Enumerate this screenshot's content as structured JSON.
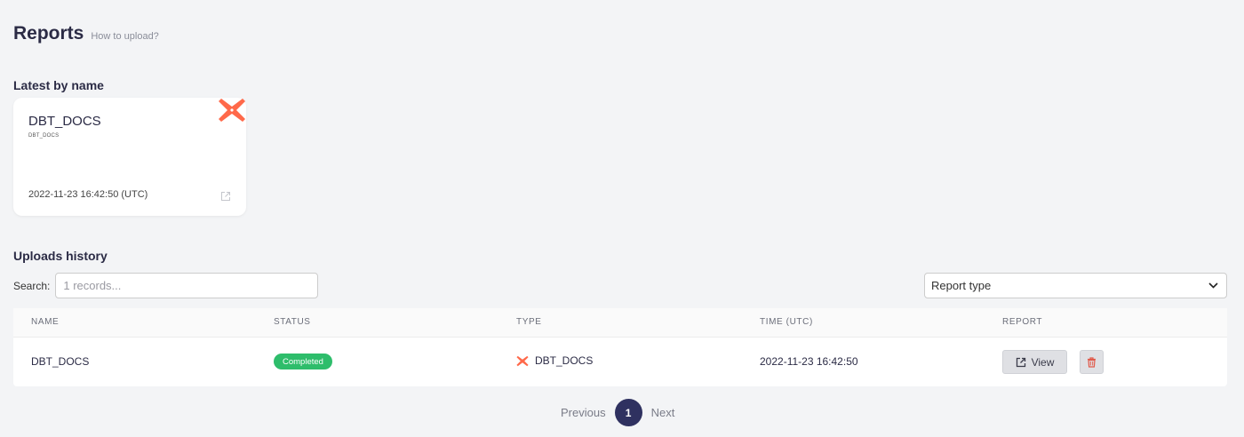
{
  "header": {
    "title": "Reports",
    "help_link": "How to upload?"
  },
  "latest": {
    "section_title": "Latest by name",
    "card": {
      "name": "DBT_DOCS",
      "subtitle": "DBT_DOCS",
      "timestamp": "2022-11-23 16:42:50 (UTC)",
      "logo_icon": "dbt-logo-icon",
      "open_icon": "external-link-icon"
    }
  },
  "history": {
    "section_title": "Uploads history",
    "search": {
      "label": "Search:",
      "placeholder": "1 records..."
    },
    "type_filter": {
      "value": "Report type",
      "icon": "chevron-down-icon"
    },
    "table": {
      "columns": [
        "NAME",
        "STATUS",
        "TYPE",
        "TIME (UTC)",
        "REPORT"
      ],
      "rows": [
        {
          "name": "DBT_DOCS",
          "status": "Completed",
          "type": "DBT_DOCS",
          "time": "2022-11-23 16:42:50",
          "view_label": "View"
        }
      ]
    },
    "status_color": "#2ebd6b"
  },
  "pagination": {
    "previous": "Previous",
    "current": "1",
    "next": "Next"
  },
  "colors": {
    "accent": "#2f3160",
    "dbt_orange": "#ff694a",
    "delete_red": "#e05a4b"
  }
}
